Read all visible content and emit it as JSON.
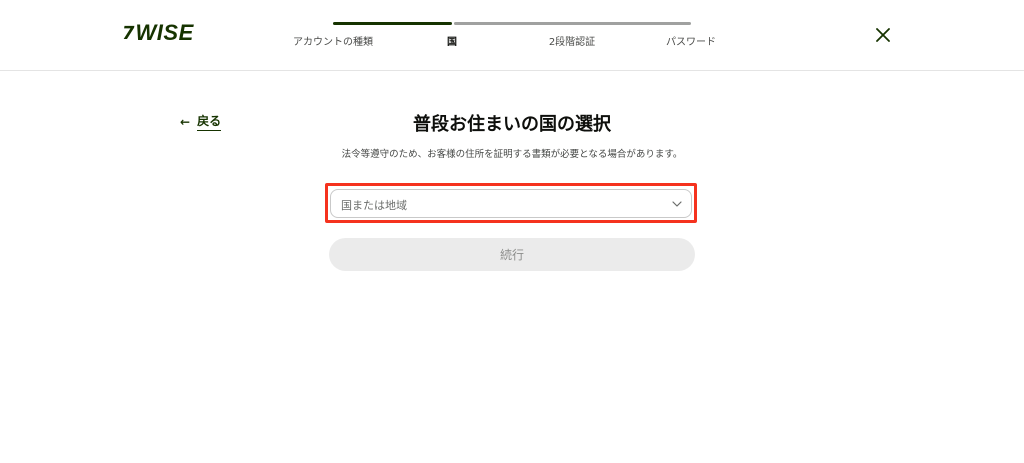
{
  "brand": {
    "logo_text": "WISE",
    "logo_flag": "7",
    "color": "#163300"
  },
  "stepper": {
    "steps": [
      {
        "label": "アカウントの種類",
        "state": "done"
      },
      {
        "label": "国",
        "state": "current"
      },
      {
        "label": "2段階認証",
        "state": "todo"
      },
      {
        "label": "パスワード",
        "state": "todo"
      }
    ]
  },
  "header": {
    "close_icon": "close-icon"
  },
  "back": {
    "label": "戻る",
    "icon": "arrow-left-icon"
  },
  "main": {
    "title": "普段お住まいの国の選択",
    "subtitle": "法令等遵守のため、お客様の住所を証明する書類が必要となる場合があります。",
    "country_select": {
      "placeholder": "国または地域",
      "icon": "chevron-down-icon"
    },
    "continue_label": "続行"
  },
  "colors": {
    "accent": "#163300",
    "highlight": "#f5321e",
    "button_disabled_bg": "#ebebeb"
  }
}
